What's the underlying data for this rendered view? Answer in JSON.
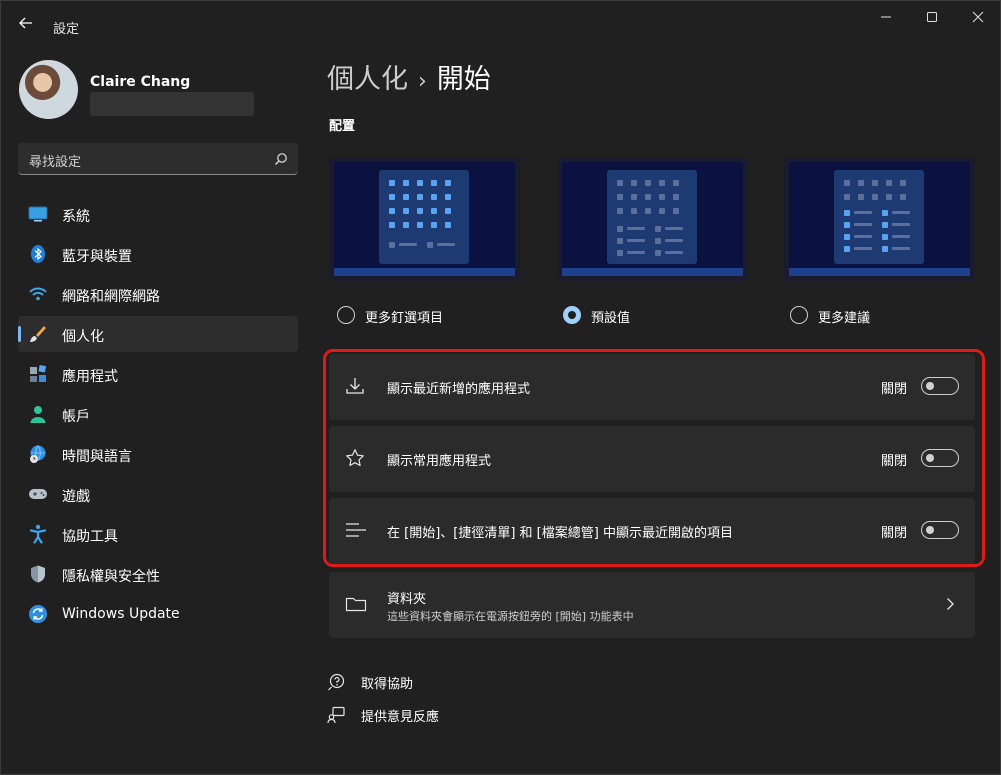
{
  "window": {
    "title": "設定",
    "controls": {
      "minimize": "—",
      "maximize": "☐",
      "close": "✕"
    }
  },
  "profile": {
    "name": "Claire Chang"
  },
  "search": {
    "placeholder": "尋找設定"
  },
  "sidebar": {
    "items": [
      {
        "label": "系統",
        "icon": "monitor-icon"
      },
      {
        "label": "藍牙與裝置",
        "icon": "bluetooth-icon"
      },
      {
        "label": "網路和網際網路",
        "icon": "wifi-icon"
      },
      {
        "label": "個人化",
        "icon": "brush-icon",
        "active": true
      },
      {
        "label": "應用程式",
        "icon": "apps-icon"
      },
      {
        "label": "帳戶",
        "icon": "person-icon"
      },
      {
        "label": "時間與語言",
        "icon": "globe-clock-icon"
      },
      {
        "label": "遊戲",
        "icon": "gamepad-icon"
      },
      {
        "label": "協助工具",
        "icon": "accessibility-icon"
      },
      {
        "label": "隱私權與安全性",
        "icon": "shield-icon"
      },
      {
        "label": "Windows Update",
        "icon": "update-icon"
      }
    ]
  },
  "main": {
    "breadcrumb": {
      "parent": "個人化",
      "separator": "›",
      "current": "開始"
    },
    "layout_section": "配置",
    "layouts": [
      {
        "label": "更多釘選項目",
        "selected": false
      },
      {
        "label": "預設值",
        "selected": true
      },
      {
        "label": "更多建議",
        "selected": false
      }
    ],
    "settings": [
      {
        "label": "顯示最近新增的應用程式",
        "state": "關閉",
        "icon": "download-icon"
      },
      {
        "label": "顯示常用應用程式",
        "state": "關閉",
        "icon": "star-icon"
      },
      {
        "label": "在 [開始]、[捷徑清單] 和 [檔案總管] 中顯示最近開啟的項目",
        "state": "關閉",
        "icon": "list-icon"
      }
    ],
    "folders": {
      "title": "資料夾",
      "subtitle": "這些資料夾會顯示在電源按鈕旁的 [開始] 功能表中"
    },
    "links": [
      {
        "label": "取得協助",
        "icon": "help-icon"
      },
      {
        "label": "提供意見反應",
        "icon": "feedback-icon"
      }
    ]
  },
  "colors": {
    "background": "#202020",
    "card": "#2b2b2b",
    "accent": "#76b9ed",
    "highlight_border": "#e01919"
  }
}
